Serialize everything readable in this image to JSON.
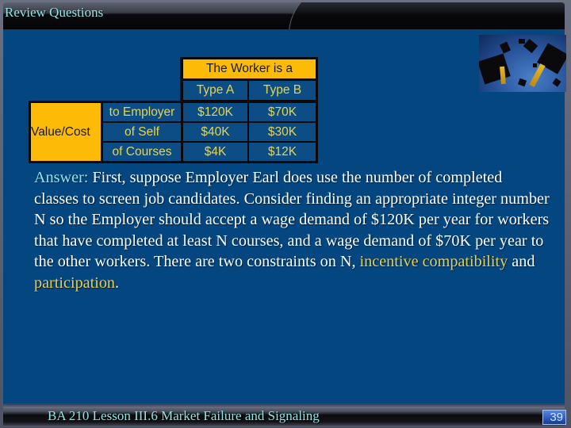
{
  "header": {
    "title": "Review Questions"
  },
  "table": {
    "header_title": "The Worker is a",
    "columns": [
      "Type A",
      "Type B"
    ],
    "row_group_label": "Value/Cost",
    "rows": [
      {
        "label": "to Employer",
        "values": [
          "$120K",
          "$70K"
        ]
      },
      {
        "label": "of Self",
        "values": [
          "$40K",
          "$30K"
        ]
      },
      {
        "label": "of Courses",
        "values": [
          "$4K",
          "$12K"
        ]
      }
    ]
  },
  "answer": {
    "label": "Answer:",
    "text_before": " First, suppose Employer Earl does use the number of completed classes to screen job candidates. Consider finding an appropriate integer number N so the Employer should accept a wage demand of $120K per year for workers that have completed at least N courses, and a wage demand of $70K per year to the other workers.  There are two constraints on N, ",
    "highlight_1": "incentive compatibility",
    "middle": " and ",
    "highlight_2": "participation",
    "end": "."
  },
  "footer": {
    "course": "BA 210  Lesson III.6 Market Failure and Signaling",
    "page_number": "39"
  },
  "image": {
    "icon": "graduation-caps-photo"
  },
  "colors": {
    "background": "#034680",
    "table_header": "#fdbb08",
    "table_text": "#e8d44a",
    "title_text": "#8ee6e6",
    "highlight": "#e6cf52"
  }
}
